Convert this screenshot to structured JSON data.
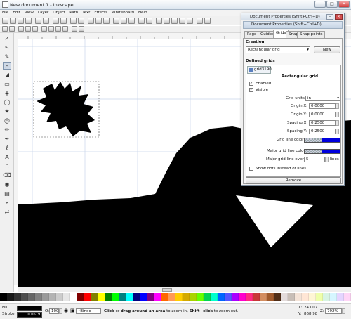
{
  "window": {
    "title": "New document 1 - Inkscape"
  },
  "window_buttons": {
    "minimize": "–",
    "maximize": "□",
    "close": "✕"
  },
  "menu": [
    "File",
    "Edit",
    "View",
    "Layer",
    "Object",
    "Path",
    "Text",
    "Effects",
    "Whiteboard",
    "Help"
  ],
  "icons": {
    "toolbox": [
      "selector-icon",
      "node-icon",
      "tweak-icon",
      "zoom-icon",
      "measure-icon",
      "rect-icon",
      "3dbox-icon",
      "ellipse-icon",
      "star-icon",
      "spiral-icon",
      "pencil-icon",
      "pen-icon",
      "calligraphy-icon",
      "text-icon",
      "spray-icon",
      "eraser-icon",
      "bucket-icon",
      "gradient-icon",
      "dropper-icon",
      "connector-icon"
    ]
  },
  "dialog": {
    "window_title": "Document Properties (Shift+Ctrl+D)",
    "panel_title": "Document Properties (Shift+Ctrl+D)",
    "tabs": [
      "Page",
      "Guides",
      "Grids",
      "Snap",
      "Snap points"
    ],
    "active_tab": "Grids",
    "creation_label": "Creation",
    "grid_type": "Rectangular grid",
    "new_button": "New",
    "defined_grids_label": "Defined grids",
    "grid_tab": "grid3190",
    "grid_heading": "Rectangular grid",
    "enabled_label": "Enabled",
    "visible_label": "Visible",
    "enabled": true,
    "visible": true,
    "grid_units_label": "Grid units:",
    "grid_units_value": "in",
    "origin_x_label": "Origin X:",
    "origin_x": "0.0000",
    "origin_y_label": "Origin Y:",
    "origin_y": "0.0000",
    "spacing_x_label": "Spacing X:",
    "spacing_x": "0.2500",
    "spacing_y_label": "Spacing Y:",
    "spacing_y": "0.2500",
    "grid_line_color_label": "Grid line color:",
    "major_grid_line_color_label": "Major grid line color:",
    "major_grid_every_label": "Major grid line every:",
    "major_grid_every_value": "5",
    "major_grid_every_unit": "lines",
    "show_dots_label": "Show dots instead of lines",
    "remove_button": "Remove",
    "grid_color": "#0000dd"
  },
  "statusbar": {
    "fill_label": "Fill:",
    "stroke_label": "Stroke:",
    "stroke_width": "0.0679",
    "opacity_label": "O:",
    "opacity_value": "100",
    "layer_name": "•Bindo",
    "message_bold_1": "Click",
    "message_1": " or ",
    "message_bold_2": "drag around an area",
    "message_2": " to zoom in, ",
    "message_bold_3": "Shift+click",
    "message_3": " to zoom out.",
    "x_label": "X:",
    "x_value": "243.07",
    "y_label": "Y:",
    "y_value": "868.98",
    "z_label": "Z:",
    "zoom_value": "792%"
  },
  "palette_colors": [
    "#000000",
    "#1a1a1a",
    "#333333",
    "#4d4d4d",
    "#666666",
    "#808080",
    "#999999",
    "#b3b3b3",
    "#cccccc",
    "#e6e6e6",
    "#ffffff",
    "#800000",
    "#ff0000",
    "#808000",
    "#ffff00",
    "#008000",
    "#00ff00",
    "#008080",
    "#00ffff",
    "#000080",
    "#0000ff",
    "#800080",
    "#ff00ff",
    "#ff6600",
    "#ff9955",
    "#ffcc00",
    "#d4aa00",
    "#aad400",
    "#66ff00",
    "#00d455",
    "#00ffcc",
    "#0066ff",
    "#5555ff",
    "#aa00ff",
    "#ff00cc",
    "#ff2a7f",
    "#c83737",
    "#d38d5f",
    "#a05a2c",
    "#502d16",
    "#e3dbdb",
    "#c8beb7",
    "#f4e3d7",
    "#ffe6d5",
    "#fff6d5",
    "#eeffaa",
    "#d7f4e3",
    "#d5f6ff",
    "#e5d5ff",
    "#ffd5f6"
  ]
}
